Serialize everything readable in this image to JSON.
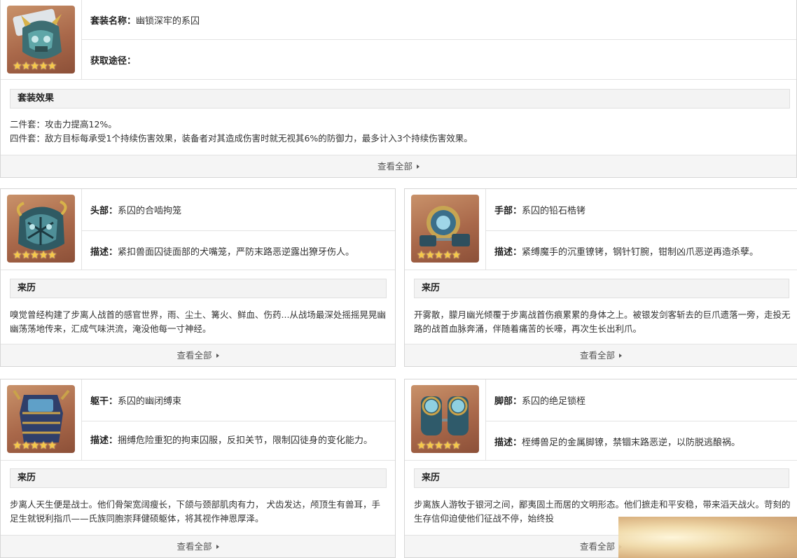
{
  "set": {
    "name_label": "套装名称：",
    "name_value": "幽锁深牢的系囚",
    "source_label": "获取途径：",
    "source_value": "",
    "effects_title": "套装效果",
    "effect_2": "二件套：攻击力提高12%。",
    "effect_4": "四件套：敌方目标每承受1个持续伤害效果，装备者对其造成伤害时就无视其6%的防御力，最多计入3个持续伤害效果。",
    "view_all": "查看全部"
  },
  "pieces": [
    {
      "slot_label": "头部：",
      "name": "系囚的合啮拘笼",
      "desc_label": "描述：",
      "desc": "紧扣兽面囚徒面部的犬嘴笼，严防末路恶逆露出獠牙伤人。",
      "history_title": "来历",
      "history": "嗅觉曾经构建了步离人战首的感官世界，雨、尘土、篝火、鲜血、伤药...从战场最深处摇摇晃晃幽幽荡荡地传来，汇成气味洪流，淹没他每一寸神经。",
      "view_all": "查看全部"
    },
    {
      "slot_label": "手部：",
      "name": "系囚的铅石梏铐",
      "desc_label": "描述：",
      "desc": "紧缚魔手的沉重镣铐，钢针钉腕，钳制凶爪恶逆再造杀孽。",
      "history_title": "来历",
      "history": "开雾散，朦月幽光倾覆于步离战首伤痕累累的身体之上。被银发剑客斩去的巨爪遗落一旁，走投无路的战首血脉奔涌，伴随着痛苦的长嚎，再次生长出利爪。",
      "view_all": "查看全部"
    },
    {
      "slot_label": "躯干：",
      "name": "系囚的幽闭缚束",
      "desc_label": "描述：",
      "desc": "捆缚危险重犯的拘束囚服，反扣关节，限制囚徒身的变化能力。",
      "history_title": "来历",
      "history": "步离人天生便是战士。他们骨架宽阔瘦长，下颌与颈部肌肉有力，  犬齿发达，颅顶生有兽耳，手足生就锐利指爪——氏族同胞崇拜健硕躯体，将其视作神恩厚泽。",
      "view_all": "查看全部"
    },
    {
      "slot_label": "脚部：",
      "name": "系囚的绝足锁桎",
      "desc_label": "描述：",
      "desc": "桎缚兽足的金属脚镣，禁锢末路恶逆，以防脱逃酿祸。",
      "history_title": "来历",
      "history": "步离族人游牧于银河之间，鄙夷固土而居的文明形态。他们摭走和平安稳，带来滔天战火。苛刻的生存信仰迫使他们征战不停，始终投",
      "view_all": "查看全部"
    }
  ],
  "icons": {
    "rarity": "★★★★★",
    "set_icon": "mask-helmet-icon",
    "head_icon": "muzzle-cage-icon",
    "hands_icon": "shackle-icon",
    "body_icon": "straitjacket-icon",
    "feet_icon": "leg-iron-icon"
  },
  "colors": {
    "icon_bg": "#a9684a",
    "star": "#f7c948",
    "bar_bg": "#f3f3f3"
  }
}
